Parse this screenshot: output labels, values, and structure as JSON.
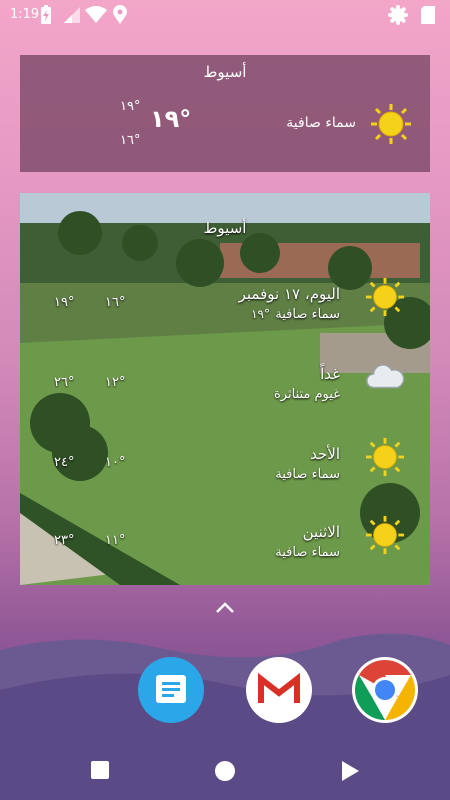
{
  "status_bar": {
    "time": "1:19",
    "icons": [
      "battery-charging-icon",
      "signal-icon",
      "wifi-icon",
      "location-icon",
      "settings-icon",
      "sd-card-icon"
    ]
  },
  "small_widget": {
    "city": "أسيوط",
    "current_temp": "١٩°",
    "high": "١٩°",
    "low": "١٦°",
    "condition": "سماء صافية",
    "icon": "sun-icon"
  },
  "forecast_widget": {
    "city": "أسيوط",
    "days": [
      {
        "name": "اليوم، ١٧ نوفمبر",
        "condition": "سماء صافية",
        "extra": "١٩°",
        "high": "١٦°",
        "low": "١٩°",
        "icon": "sun-icon"
      },
      {
        "name": "غداً",
        "condition": "غيوم متناثرة",
        "extra": "",
        "high": "١٢°",
        "low": "٢٦°",
        "icon": "cloud-icon"
      },
      {
        "name": "الأحد",
        "condition": "سماء صافية",
        "extra": "",
        "high": "١٠°",
        "low": "٢٤°",
        "icon": "sun-icon"
      },
      {
        "name": "الاثنين",
        "condition": "سماء صافية",
        "extra": "",
        "high": "١١°",
        "low": "٢٣°",
        "icon": "sun-icon"
      }
    ]
  },
  "dock": {
    "apps": [
      "Messages",
      "Gmail",
      "Chrome"
    ]
  },
  "nav": [
    "square-icon",
    "circle-icon",
    "triangle-icon"
  ],
  "colors": {
    "widget_bg": "#7a4664",
    "sun": "#f5d21a",
    "accent_pink": "#e79ac4"
  }
}
